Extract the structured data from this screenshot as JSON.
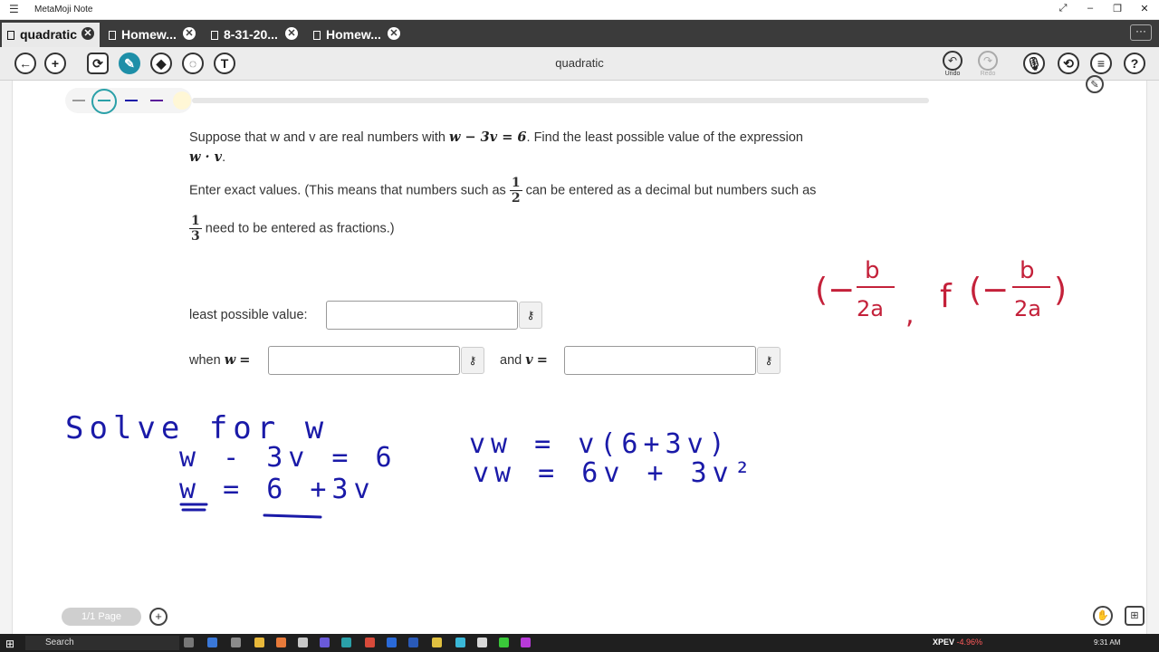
{
  "window": {
    "app_title": "MetaMoji Note"
  },
  "tabs": [
    {
      "label": "quadratic",
      "active": true
    },
    {
      "label": "Homew..."
    },
    {
      "label": "8-31-20..."
    },
    {
      "label": "Homew..."
    }
  ],
  "toolbar": {
    "doc_title": "quadratic",
    "undo_label": "Undo",
    "redo_label": "Redo"
  },
  "question": {
    "intro_a": "Suppose that w  and v are real numbers with",
    "equation": "w − 3v = 6",
    "intro_b": ".  Find the least possible value of the expression",
    "expr": "w · v",
    "expr_end": ".",
    "exact_a": "Enter exact values.  (This means that numbers such as",
    "half_num": "1",
    "half_den": "2",
    "exact_b": "can be entered as a decimal but numbers such as",
    "third_num": "1",
    "third_den": "3",
    "exact_c": "need to be entered as   fractions.)",
    "least_label": "least possible value:",
    "when_label": "when",
    "w_var": "w",
    "eq_sign": "=",
    "and_label": "and",
    "v_var": "v"
  },
  "ink": {
    "vertex_formula": "(−b/2a, f(−b/2a))",
    "solve_heading": "Solve for w",
    "step1": "w - 3v = 6",
    "step2": "w = 6 +3v",
    "sub1": "vw = v(6+3v)",
    "sub2": "vw = 6v + 3v²",
    "blue": "#1a1aa8",
    "red": "#c4213a"
  },
  "footer": {
    "page_indicator": "1/1 Page"
  },
  "taskbar": {
    "search": "Search",
    "ticker_symbol": "XPEV",
    "ticker_change": "-4.96%",
    "clock": "9:31 AM"
  },
  "colors": {
    "pen_active": "#1e8fa8",
    "tabbar": "#3b3b3b"
  }
}
